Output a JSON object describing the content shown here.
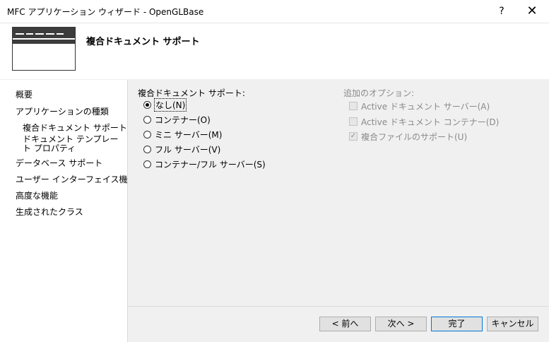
{
  "window": {
    "title": "MFC アプリケーション ウィザード - OpenGLBase",
    "help_label": "?",
    "close_label": "✕"
  },
  "header": {
    "title": "複合ドキュメント サポート"
  },
  "sidebar": {
    "items": [
      {
        "label": "概要"
      },
      {
        "label": "アプリケーションの種類"
      },
      {
        "label": "複合ドキュメント サポート"
      },
      {
        "label": "ドキュメント テンプレート プロパティ"
      },
      {
        "label": "データベース サポート"
      },
      {
        "label": "ユーザー インターフェイス機能"
      },
      {
        "label": "高度な機能"
      },
      {
        "label": "生成されたクラス"
      }
    ]
  },
  "compound": {
    "label": "複合ドキュメント サポート:",
    "selected": 0,
    "options": [
      {
        "label": "なし(N)"
      },
      {
        "label": "コンテナー(O)"
      },
      {
        "label": "ミニ サーバー(M)"
      },
      {
        "label": "フル サーバー(V)"
      },
      {
        "label": "コンテナー/フル サーバー(S)"
      }
    ]
  },
  "additional": {
    "label": "追加のオプション:",
    "options": [
      {
        "label": "Active ドキュメント サーバー(A)",
        "checked": false,
        "enabled": false
      },
      {
        "label": "Active ドキュメント コンテナー(D)",
        "checked": false,
        "enabled": false
      },
      {
        "label": "複合ファイルのサポート(U)",
        "checked": true,
        "enabled": false
      }
    ]
  },
  "buttons": {
    "back": "< 前へ",
    "next": "次へ >",
    "finish": "完了",
    "cancel": "キャンセル"
  }
}
